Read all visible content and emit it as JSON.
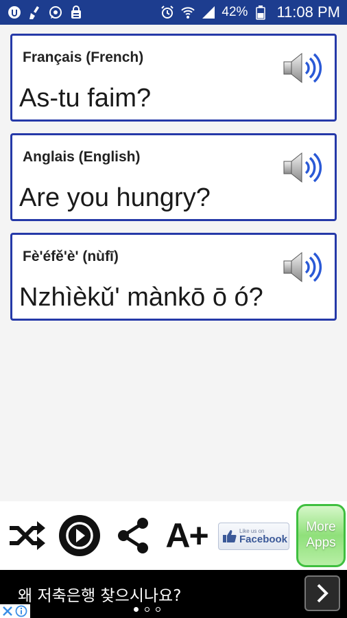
{
  "status_bar": {
    "battery_percent": "42%",
    "time": "11:08 PM",
    "icons": [
      "app-icon",
      "cleaner-icon",
      "whatsapp-icon",
      "lock-bag-icon",
      "alarm-icon",
      "wifi-icon",
      "signal-icon",
      "battery-icon"
    ]
  },
  "cards": [
    {
      "language": "Français (French)",
      "phrase": "As-tu faim?"
    },
    {
      "language": "Anglais (English)",
      "phrase": "Are you hungry?"
    },
    {
      "language": "Fè'éfě'è' (nùfī)",
      "phrase": "Nzhìèkǔ' mànkō ō ó?"
    }
  ],
  "toolbar": {
    "font_size_label": "A+",
    "facebook_small": "Like us on",
    "facebook_big": "Facebook",
    "more_apps_line1": "More",
    "more_apps_line2": "Apps",
    "icons": [
      "shuffle-icon",
      "play-icon",
      "share-icon",
      "font-size-icon",
      "facebook-like-icon"
    ]
  },
  "ad": {
    "text": "왜 저축은행 찾으시나요?",
    "page_count": 3,
    "active_page": 1
  },
  "colors": {
    "status_bar": "#1d3d8f",
    "card_border": "#2539a8",
    "speaker_blue": "#2a59d6",
    "more_apps_green": "#3fbf3f"
  }
}
